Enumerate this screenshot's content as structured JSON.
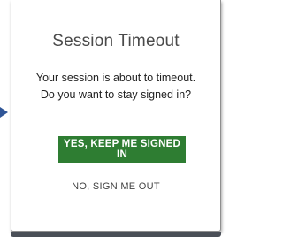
{
  "dialog": {
    "title": "Session Timeout",
    "message_line1": "Your session is about to timeout.",
    "message_line2": "Do you want to stay signed in?",
    "primary_button_label": "YES, KEEP ME SIGNED IN",
    "secondary_link_label": "NO, SIGN ME OUT"
  },
  "colors": {
    "primary_button": "#2e7d32",
    "arrow": "#2f5597",
    "bottom_bar": "#4a4f57"
  },
  "icons": {
    "pointer": "arrow-right-icon"
  }
}
